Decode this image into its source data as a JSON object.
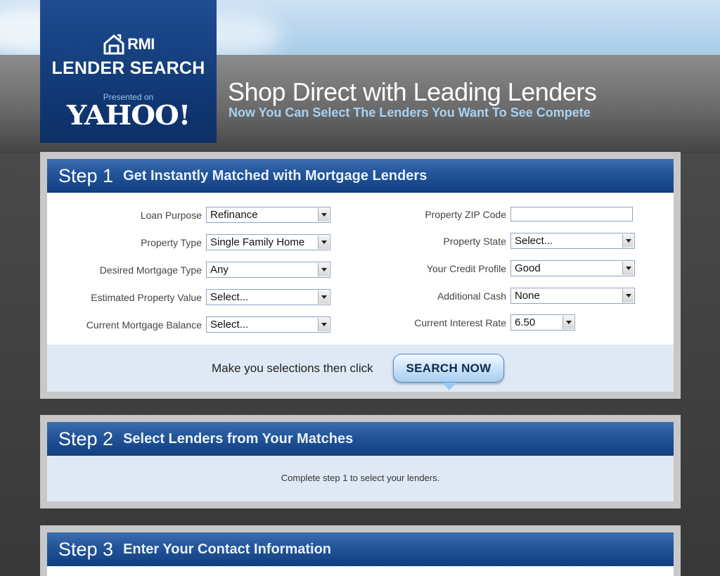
{
  "brand": {
    "logo_name": "RMI",
    "product": "LENDER SEARCH",
    "presented_on": "Presented on",
    "partner": "YAHOO!",
    "brand_color": "#133b78"
  },
  "hero": {
    "headline": "Shop Direct with Leading Lenders",
    "subline": "Now You Can Select The Lenders You Want To See Compete"
  },
  "step1": {
    "num": "Step 1",
    "title": "Get Instantly Matched with Mortgage Lenders",
    "left_fields": [
      {
        "label": "Loan Purpose",
        "value": "Refinance"
      },
      {
        "label": "Property Type",
        "value": "Single Family Home"
      },
      {
        "label": "Desired Mortgage Type",
        "value": "Any"
      },
      {
        "label": "Estimated Property Value",
        "value": "Select..."
      },
      {
        "label": "Current Mortgage Balance",
        "value": "Select..."
      }
    ],
    "right_fields": [
      {
        "label": "Property ZIP Code",
        "value": ""
      },
      {
        "label": "Property State",
        "value": "Select..."
      },
      {
        "label": "Your Credit Profile",
        "value": "Good"
      },
      {
        "label": "Additional Cash",
        "value": "None"
      },
      {
        "label": "Current Interest Rate",
        "value": "6.50"
      }
    ],
    "prompt": "Make you selections then click",
    "button": "SEARCH NOW"
  },
  "step2": {
    "num": "Step 2",
    "title": "Select Lenders from Your Matches",
    "message": "Complete step 1 to select your lenders."
  },
  "step3": {
    "num": "Step 3",
    "title": "Enter Your Contact Information"
  }
}
